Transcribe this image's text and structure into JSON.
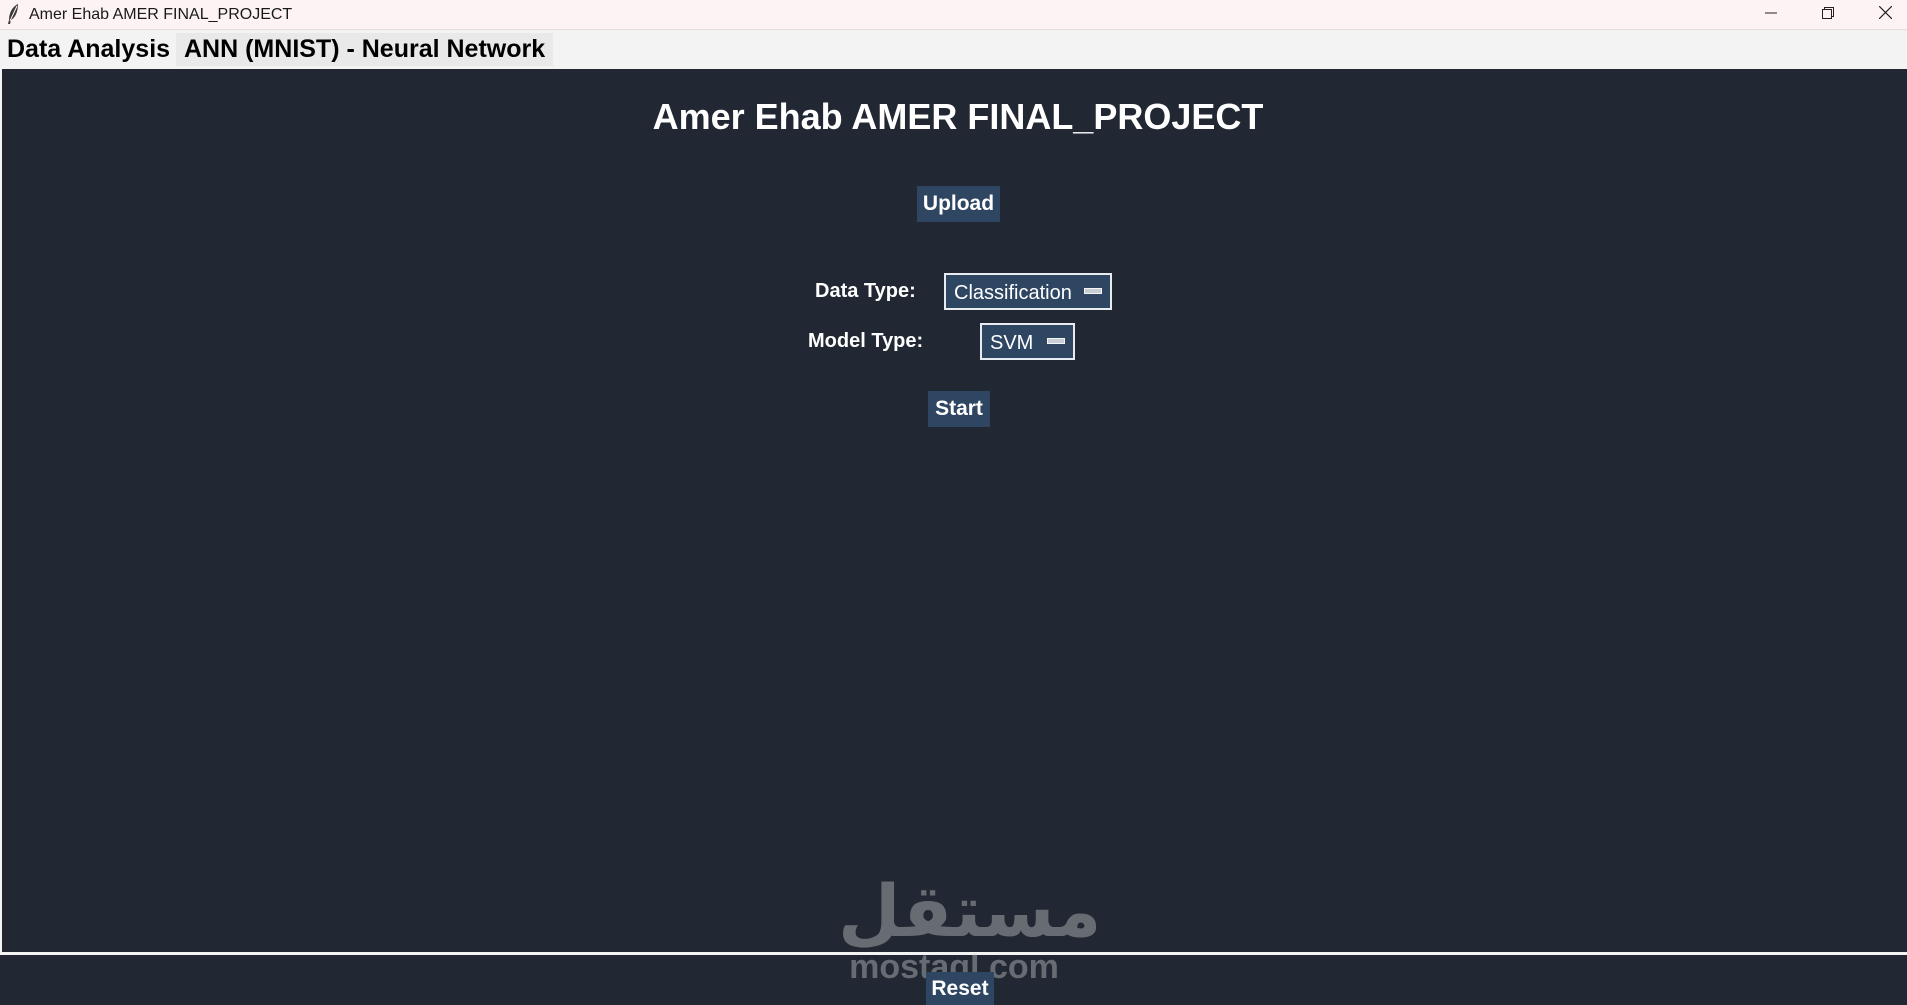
{
  "window": {
    "title": "Amer Ehab AMER FINAL_PROJECT",
    "icon": "feather-icon",
    "controls": [
      "minimize-icon",
      "restore-icon",
      "close-icon"
    ]
  },
  "tabs": [
    {
      "label": "Data Analysis",
      "active": true
    },
    {
      "label": "ANN (MNIST) - Neural Network",
      "active": false
    }
  ],
  "main": {
    "title": "Amer Ehab AMER FINAL_PROJECT",
    "upload_label": "Upload",
    "data_type_label": "Data Type:",
    "data_type_value": "Classification",
    "model_type_label": "Model Type:",
    "model_type_value": "SVM",
    "start_label": "Start",
    "reset_label": "Reset"
  },
  "watermark": {
    "arabic": "مستقل",
    "latin": "mostaql.com"
  },
  "colors": {
    "background": "#222833",
    "button": "#2e4662",
    "text": "#ffffff",
    "titlebar": "#fdf3f4"
  }
}
